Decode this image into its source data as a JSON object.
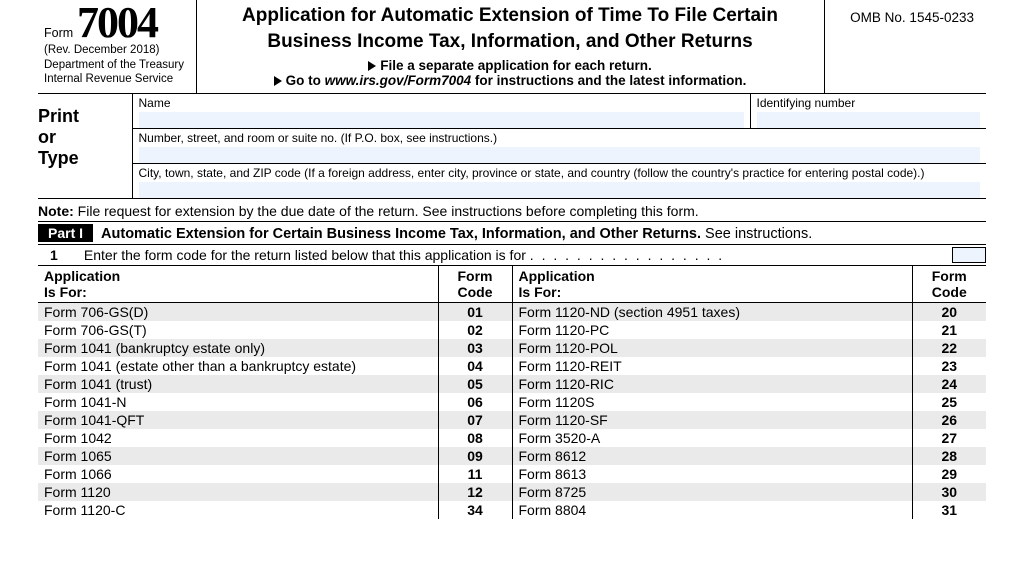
{
  "header": {
    "form_word": "Form",
    "form_number": "7004",
    "revision": "(Rev. December 2018)",
    "dept1": "Department of the Treasury",
    "dept2": "Internal Revenue Service",
    "title1": "Application for Automatic Extension of Time To File Certain",
    "title2": "Business Income Tax, Information, and Other Returns",
    "sub1": "File a separate application for each return.",
    "sub2_pre": "Go to ",
    "sub2_url": "www.irs.gov/Form7004",
    "sub2_post": " for instructions and the latest information.",
    "omb": "OMB No. 1545-0233"
  },
  "ident": {
    "print_or_type": "Print\nor\nType",
    "name_label": "Name",
    "id_label": "Identifying number",
    "street_label": "Number, street, and room or suite no. (If P.O. box, see instructions.)",
    "city_label": "City, town, state, and ZIP code (If a foreign address, enter city, province or state, and country (follow the country's practice for entering postal code).)"
  },
  "note": {
    "bold": "Note:",
    "text": " File request for extension by the due date of the return. See instructions before completing this form."
  },
  "part": {
    "tab": "Part I",
    "title_bold": "Automatic Extension for Certain Business Income Tax, Information, and Other Returns.",
    "title_rest": " See instructions."
  },
  "line1": {
    "num": "1",
    "text": "Enter the form code for the return listed below that this application is for"
  },
  "table": {
    "hdr_app": "Application\nIs For:",
    "hdr_code": "Form\nCode",
    "rows_left": [
      {
        "app": "Form 706-GS(D)",
        "code": "01"
      },
      {
        "app": "Form 706-GS(T)",
        "code": "02"
      },
      {
        "app": "Form 1041 (bankruptcy estate only)",
        "code": "03"
      },
      {
        "app": "Form 1041 (estate other than a bankruptcy estate)",
        "code": "04"
      },
      {
        "app": "Form 1041 (trust)",
        "code": "05"
      },
      {
        "app": "Form 1041-N",
        "code": "06"
      },
      {
        "app": "Form 1041-QFT",
        "code": "07"
      },
      {
        "app": "Form 1042",
        "code": "08"
      },
      {
        "app": "Form 1065",
        "code": "09"
      },
      {
        "app": "Form 1066",
        "code": "11"
      },
      {
        "app": "Form 1120",
        "code": "12"
      },
      {
        "app": "Form 1120-C",
        "code": "34"
      }
    ],
    "rows_right": [
      {
        "app": "Form 1120-ND (section 4951 taxes)",
        "code": "20"
      },
      {
        "app": "Form 1120-PC",
        "code": "21"
      },
      {
        "app": "Form 1120-POL",
        "code": "22"
      },
      {
        "app": "Form 1120-REIT",
        "code": "23"
      },
      {
        "app": "Form 1120-RIC",
        "code": "24"
      },
      {
        "app": "Form 1120S",
        "code": "25"
      },
      {
        "app": "Form 1120-SF",
        "code": "26"
      },
      {
        "app": "Form 3520-A",
        "code": "27"
      },
      {
        "app": "Form 8612",
        "code": "28"
      },
      {
        "app": "Form 8613",
        "code": "29"
      },
      {
        "app": "Form 8725",
        "code": "30"
      },
      {
        "app": "Form 8804",
        "code": "31"
      }
    ]
  }
}
